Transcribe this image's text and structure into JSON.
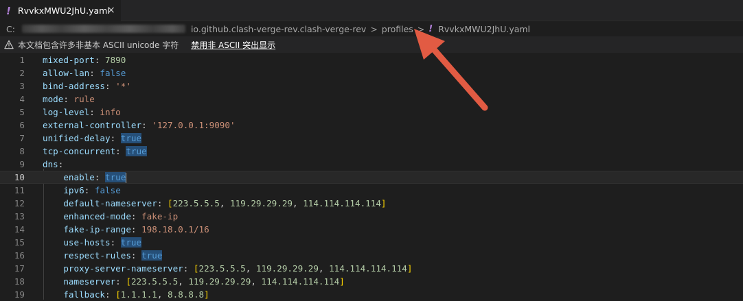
{
  "tab": {
    "icon": "exclamation-icon",
    "label": "RvvkxMWU2JhU.yaml",
    "close": "×"
  },
  "breadcrumb": {
    "drive": "C:",
    "items": [
      "io.github.clash-verge-rev.clash-verge-rev",
      "profiles"
    ],
    "separator": ">",
    "file": "RvvkxMWU2JhU.yaml"
  },
  "banner": {
    "text": "本文档包含许多非基本 ASCII unicode 字符",
    "link": "禁用非 ASCII 突出显示"
  },
  "colors": {
    "yaml_icon": "#b180d7",
    "arrow": "#e25b43"
  },
  "editor": {
    "current_line": 10,
    "lines": [
      {
        "n": "1",
        "tokens": [
          [
            "k",
            "mixed-port"
          ],
          [
            "p",
            ": "
          ],
          [
            "n",
            "7890"
          ]
        ]
      },
      {
        "n": "2",
        "tokens": [
          [
            "k",
            "allow-lan"
          ],
          [
            "p",
            ": "
          ],
          [
            "b",
            "false"
          ]
        ]
      },
      {
        "n": "3",
        "tokens": [
          [
            "k",
            "bind-address"
          ],
          [
            "p",
            ": "
          ],
          [
            "s",
            "'*'"
          ]
        ]
      },
      {
        "n": "4",
        "tokens": [
          [
            "k",
            "mode"
          ],
          [
            "p",
            ": "
          ],
          [
            "s",
            "rule"
          ]
        ]
      },
      {
        "n": "5",
        "tokens": [
          [
            "k",
            "log-level"
          ],
          [
            "p",
            ": "
          ],
          [
            "s",
            "info"
          ]
        ]
      },
      {
        "n": "6",
        "tokens": [
          [
            "k",
            "external-controller"
          ],
          [
            "p",
            ": "
          ],
          [
            "s",
            "'127.0.0.1:9090'"
          ]
        ]
      },
      {
        "n": "7",
        "tokens": [
          [
            "k",
            "unified-delay"
          ],
          [
            "p",
            ": "
          ],
          [
            "bh",
            "true"
          ]
        ]
      },
      {
        "n": "8",
        "tokens": [
          [
            "k",
            "tcp-concurrent"
          ],
          [
            "p",
            ": "
          ],
          [
            "bh",
            "true"
          ]
        ]
      },
      {
        "n": "9",
        "tokens": [
          [
            "k",
            "dns"
          ],
          [
            "p",
            ":"
          ]
        ]
      },
      {
        "n": "10",
        "tokens": [
          [
            "p",
            "    "
          ],
          [
            "k",
            "enable"
          ],
          [
            "p",
            ": "
          ],
          [
            "bh",
            "true"
          ],
          [
            "cursor",
            ""
          ]
        ]
      },
      {
        "n": "11",
        "tokens": [
          [
            "p",
            "    "
          ],
          [
            "k",
            "ipv6"
          ],
          [
            "p",
            ": "
          ],
          [
            "b",
            "false"
          ]
        ]
      },
      {
        "n": "12",
        "tokens": [
          [
            "p",
            "    "
          ],
          [
            "k",
            "default-nameserver"
          ],
          [
            "p",
            ": "
          ],
          [
            "br1",
            "["
          ],
          [
            "n",
            "223.5.5.5"
          ],
          [
            "p",
            ", "
          ],
          [
            "n",
            "119.29.29.29"
          ],
          [
            "p",
            ", "
          ],
          [
            "n",
            "114.114.114.114"
          ],
          [
            "br1",
            "]"
          ]
        ]
      },
      {
        "n": "13",
        "tokens": [
          [
            "p",
            "    "
          ],
          [
            "k",
            "enhanced-mode"
          ],
          [
            "p",
            ": "
          ],
          [
            "s",
            "fake-ip"
          ]
        ]
      },
      {
        "n": "14",
        "tokens": [
          [
            "p",
            "    "
          ],
          [
            "k",
            "fake-ip-range"
          ],
          [
            "p",
            ": "
          ],
          [
            "s",
            "198.18.0.1/16"
          ]
        ]
      },
      {
        "n": "15",
        "tokens": [
          [
            "p",
            "    "
          ],
          [
            "k",
            "use-hosts"
          ],
          [
            "p",
            ": "
          ],
          [
            "bh",
            "true"
          ]
        ]
      },
      {
        "n": "16",
        "tokens": [
          [
            "p",
            "    "
          ],
          [
            "k",
            "respect-rules"
          ],
          [
            "p",
            ": "
          ],
          [
            "bh",
            "true"
          ]
        ]
      },
      {
        "n": "17",
        "tokens": [
          [
            "p",
            "    "
          ],
          [
            "k",
            "proxy-server-nameserver"
          ],
          [
            "p",
            ": "
          ],
          [
            "br1",
            "["
          ],
          [
            "n",
            "223.5.5.5"
          ],
          [
            "p",
            ", "
          ],
          [
            "n",
            "119.29.29.29"
          ],
          [
            "p",
            ", "
          ],
          [
            "n",
            "114.114.114.114"
          ],
          [
            "br1",
            "]"
          ]
        ]
      },
      {
        "n": "18",
        "tokens": [
          [
            "p",
            "    "
          ],
          [
            "k",
            "nameserver"
          ],
          [
            "p",
            ": "
          ],
          [
            "br1",
            "["
          ],
          [
            "n",
            "223.5.5.5"
          ],
          [
            "p",
            ", "
          ],
          [
            "n",
            "119.29.29.29"
          ],
          [
            "p",
            ", "
          ],
          [
            "n",
            "114.114.114.114"
          ],
          [
            "br1",
            "]"
          ]
        ]
      },
      {
        "n": "19",
        "tokens": [
          [
            "p",
            "    "
          ],
          [
            "k",
            "fallback"
          ],
          [
            "p",
            ": "
          ],
          [
            "br1",
            "["
          ],
          [
            "n",
            "1.1.1.1"
          ],
          [
            "p",
            ", "
          ],
          [
            "n",
            "8.8.8.8"
          ],
          [
            "br1",
            "]"
          ]
        ]
      }
    ]
  }
}
